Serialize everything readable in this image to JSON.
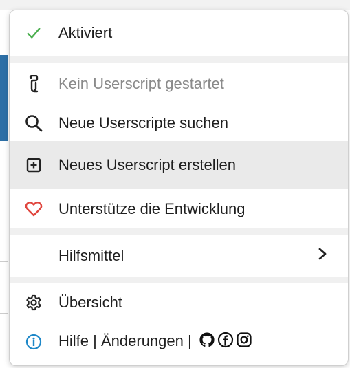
{
  "colors": {
    "check": "#4caf50",
    "heart": "#e0453d",
    "info": "#1e88c8"
  },
  "menu": {
    "activated": {
      "label": "Aktiviert",
      "icon": "checkmark-icon"
    },
    "no_script": {
      "label": "Kein Userscript gestartet",
      "icon": "script-icon"
    },
    "search": {
      "label": "Neue Userscripte suchen",
      "icon": "search-icon"
    },
    "create": {
      "label": "Neues Userscript erstellen",
      "icon": "plus-box-icon"
    },
    "support": {
      "label": "Unterstütze die Entwicklung",
      "icon": "heart-icon"
    },
    "utilities": {
      "label": "Hilfsmittel",
      "icon": "chevron-right-icon"
    },
    "overview": {
      "label": "Übersicht",
      "icon": "gear-icon"
    },
    "footer": {
      "help": "Hilfe",
      "sep1": "|",
      "changes": "Änderungen",
      "sep2": "|",
      "icons": [
        "info-icon",
        "github-icon",
        "facebook-icon",
        "instagram-icon"
      ]
    }
  }
}
